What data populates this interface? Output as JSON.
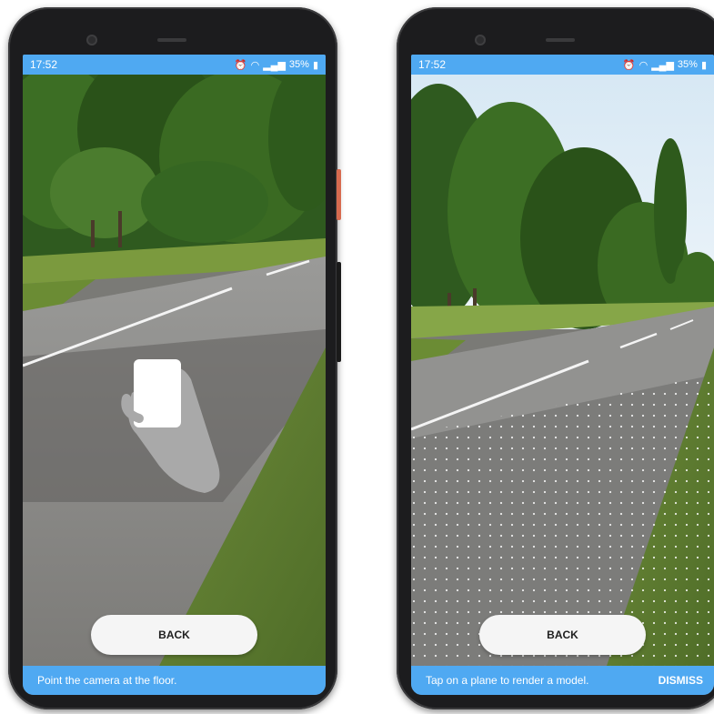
{
  "phones": [
    {
      "status": {
        "time": "17:52",
        "battery": "35%"
      },
      "hint_icon": "hand-holding-phone-icon",
      "back_label": "BACK",
      "bottom_message": "Point the camera at the floor.",
      "dismiss_label": ""
    },
    {
      "status": {
        "time": "17:52",
        "battery": "35%"
      },
      "plane_overlay": "detected-plane-dots",
      "back_label": "BACK",
      "bottom_message": "Tap on a plane to render a model.",
      "dismiss_label": "DISMISS"
    }
  ],
  "colors": {
    "accent_bar": "#4fa9f2",
    "button_bg": "#f5f5f5"
  }
}
